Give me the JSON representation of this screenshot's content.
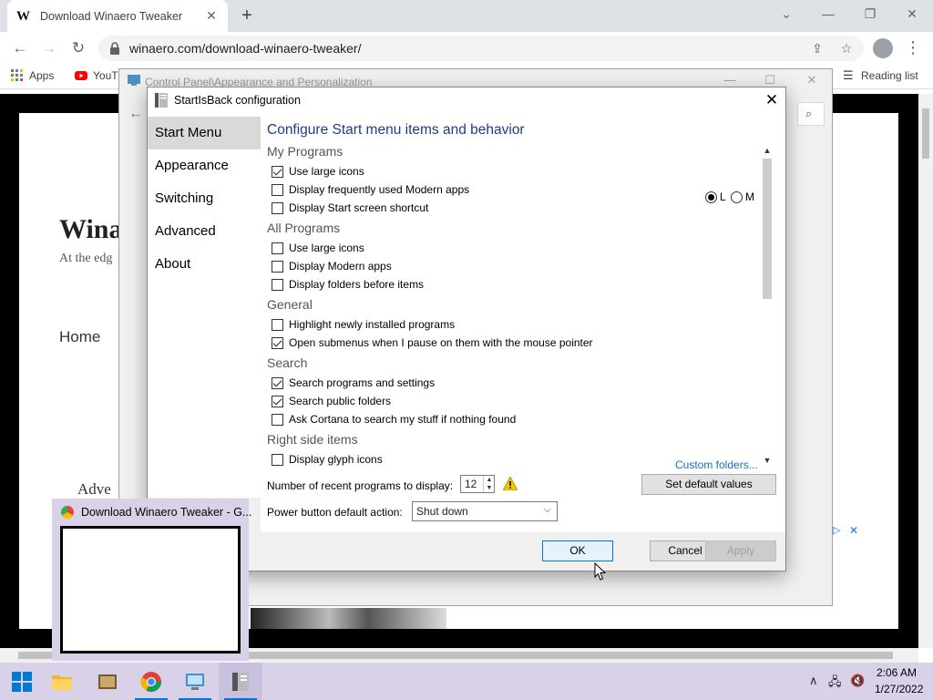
{
  "browser": {
    "tab_title": "Download Winaero Tweaker",
    "tab_favicon": "W",
    "url": "winaero.com/download-winaero-tweaker/",
    "bookmarks": [
      {
        "label": "Apps"
      },
      {
        "label": "YouT"
      }
    ],
    "reading_list": "Reading list"
  },
  "page": {
    "site_title": "Wina",
    "site_tagline": "At the edg",
    "home_link": "Home",
    "adv_text": "Adve"
  },
  "control_panel": {
    "title": "Control Panel\\Appearance and Personalization"
  },
  "dialog": {
    "title": "StartIsBack configuration",
    "nav": [
      "Start Menu",
      "Appearance",
      "Switching",
      "Advanced",
      "About"
    ],
    "selected_nav": "Start Menu",
    "heading": "Configure Start menu items and behavior",
    "groups": {
      "my_programs": "My Programs",
      "all_programs": "All Programs",
      "general": "General",
      "search": "Search",
      "right_side": "Right side items"
    },
    "options": [
      {
        "label": "Use large icons",
        "checked": true
      },
      {
        "label": "Display frequently used Modern apps",
        "checked": false
      },
      {
        "label": "Display Start screen shortcut",
        "checked": false
      },
      {
        "label": "Use large icons",
        "checked": false
      },
      {
        "label": "Display Modern apps",
        "checked": false
      },
      {
        "label": "Display folders before items",
        "checked": false
      },
      {
        "label": "Highlight newly installed programs",
        "checked": false
      },
      {
        "label": "Open submenus when I pause on them with the mouse pointer",
        "checked": true
      },
      {
        "label": "Search programs and settings",
        "checked": true
      },
      {
        "label": "Search public folders",
        "checked": true
      },
      {
        "label": "Ask Cortana to search my stuff if nothing found",
        "checked": false
      },
      {
        "label": "Display glyph icons",
        "checked": false
      }
    ],
    "icon_size_radios": [
      {
        "label": "L",
        "selected": true
      },
      {
        "label": "M",
        "selected": false
      }
    ],
    "custom_folders_link": "Custom folders...",
    "recent_label": "Number of recent programs to display:",
    "recent_value": "12",
    "set_default_label": "Set default values",
    "power_label": "Power button default action:",
    "power_value": "Shut down",
    "ok_label": "OK",
    "cancel_label": "Cancel",
    "apply_label": "Apply"
  },
  "taskbar": {
    "thumbnail_title": "Download Winaero Tweaker - G...",
    "time": "2:06 AM",
    "date": "1/27/2022"
  },
  "colors": {
    "heading_blue": "#1e3c8c",
    "link_blue": "#1a6fbf",
    "taskbar_bg": "#d9d1e8",
    "accent": "#0078d7"
  }
}
